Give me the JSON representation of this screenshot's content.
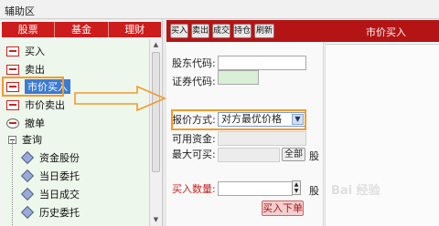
{
  "window": {
    "title": "辅助区"
  },
  "left_tabs": [
    "股票",
    "基金",
    "理财"
  ],
  "tree": {
    "items": [
      {
        "label": "买入"
      },
      {
        "label": "卖出"
      },
      {
        "label": "市价买入"
      },
      {
        "label": "市价卖出"
      },
      {
        "label": "撤单"
      },
      {
        "label": "查询"
      }
    ],
    "sub_items": [
      {
        "label": "资金股份"
      },
      {
        "label": "当日委托"
      },
      {
        "label": "当日成交"
      },
      {
        "label": "历史委托"
      }
    ]
  },
  "toolbar": {
    "buttons": [
      "买入",
      "卖出",
      "成交",
      "持仓",
      "刷新"
    ],
    "title": "市价买入"
  },
  "form": {
    "shareholder_label": "股东代码:",
    "security_label": "证券代码:",
    "price_mode_label": "报价方式:",
    "price_mode_value": "对方最优价格",
    "available_label": "可用资金:",
    "max_buy_label": "最大可买:",
    "all_button": "全部",
    "unit_shares": "股",
    "quantity_label": "买入数量:",
    "buy_button": "买入下单"
  },
  "watermark": "Bai 经验",
  "colors": {
    "brand_red": "#b41414",
    "highlight_orange": "#f39a2a",
    "selection_blue": "#3b7bd4"
  }
}
